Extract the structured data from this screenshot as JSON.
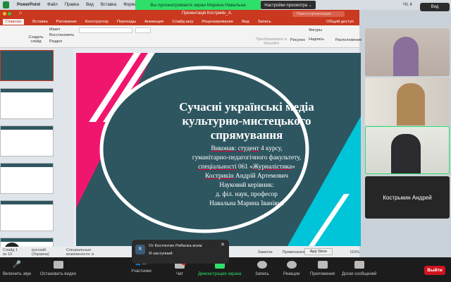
{
  "menubar": {
    "app": "PowerPoint",
    "items": [
      "Файл",
      "Правка",
      "Вид",
      "Вставка",
      "Формат"
    ],
    "clock": "Чт, 4"
  },
  "share_banner": "Вы просматриваете экран Марина Навальна",
  "view_options": "Настройки просмотра ⌄",
  "view_button": "Вид",
  "titlebar": {
    "title": "Презентація Кострикін_А.",
    "search_placeholder": "Поиск в презентации"
  },
  "ribbon_tabs": [
    "Главная",
    "Вставка",
    "Рисование",
    "Конструктор",
    "Переходы",
    "Анимация",
    "Слайд-шоу",
    "Рецензирование",
    "Вид",
    "Запись"
  ],
  "share_label": "Общий доступ",
  "ribbon": {
    "create_slide": "Создать слайд",
    "layout": "Макет",
    "restore": "Восстановить",
    "section": "Раздел",
    "smartart": "Преобразовать в SmartArt",
    "picture": "Рисунок",
    "shapes": "Фигуры",
    "textbox": "Надпись",
    "arrange": "Расположение"
  },
  "slide": {
    "title": "Сучасні українські медіа культурно-мистецького спрямування",
    "lines": [
      [
        "Виконав",
        "студент",
        " 4 курсу,"
      ],
      "гуманітарно-педагогічного факультету,",
      [
        "спеціальності",
        " 061 «",
        "Журналістика",
        "»"
      ],
      [
        "Кострикін",
        " Андрій Артемович"
      ],
      "Науковий керівник:",
      "д. філ. наук, професор",
      "Навальна Марина Іванівна"
    ]
  },
  "status": {
    "slide": "Слайд 1 из 10",
    "language": "русский (Украина)",
    "accessibility": "Специальные возможности: в",
    "notes": "Заметки",
    "comments": "Примечания",
    "zoom": "115%",
    "tooltip": "App Store"
  },
  "chat_toast": {
    "avatar": "К",
    "from": "От Костянтин Рибалка всем",
    "message": "Я наступний"
  },
  "videos": [
    {
      "name": ""
    },
    {
      "name": ""
    },
    {
      "name": ""
    },
    {
      "name": "Кострыкин Андрей"
    }
  ],
  "toolbar": {
    "audio": "Включить звук",
    "video": "Остановить видео",
    "participants": "Участники",
    "participants_count": "39",
    "chat": "Чат",
    "chat_badge": "1",
    "share": "Демонстрация экрана",
    "record": "Запись",
    "reactions": "Реакции",
    "apps": "Приложения",
    "whiteboards": "Доски сообщений",
    "leave": "Выйти"
  },
  "colors": {
    "pink": "#f0166e",
    "cyan": "#00c4d8",
    "teal": "#2e5660",
    "share_green": "#2ee06a",
    "ppt_red": "#c9381f",
    "leave_red": "#d0141e"
  }
}
